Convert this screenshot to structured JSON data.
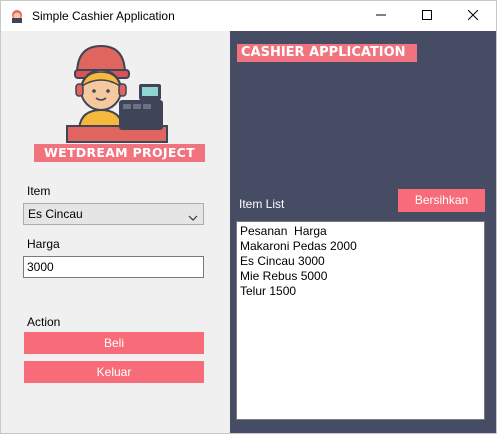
{
  "window": {
    "title": "Simple Cashier Application"
  },
  "left": {
    "logo_text": "WETDREAM PROJECT",
    "item_label": "Item",
    "item_select_value": "Es Cincau",
    "harga_label": "Harga",
    "harga_value": "3000",
    "action_label": "Action",
    "beli_button": "Beli",
    "keluar_button": "Keluar"
  },
  "right": {
    "banner": "CASHIER APPLICATION",
    "item_list_label": "Item List",
    "clear_button": "Bersihkan",
    "list_items": [
      "Pesanan  Harga",
      "Makaroni Pedas 2000",
      "Es Cincau 3000",
      "Mie Rebus 5000",
      "Telur 1500"
    ]
  },
  "colors": {
    "accent": "#f86c7a",
    "right_panel_bg": "#454c64",
    "left_panel_bg": "#f0f0f0"
  },
  "icons": {
    "app": "cashier-app-icon",
    "minimize": "minimize-icon",
    "maximize": "maximize-icon",
    "close": "close-icon",
    "logo": "cashier-illustration"
  }
}
